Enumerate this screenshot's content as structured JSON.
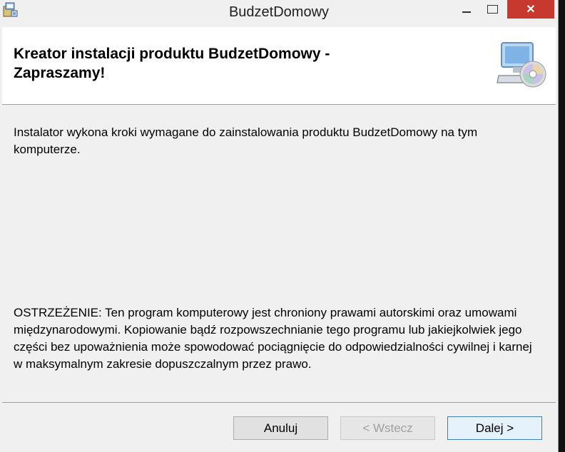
{
  "window": {
    "title": "BudzetDomowy",
    "icons": {
      "app": "installer-package-icon",
      "header": "computer-cd-icon"
    },
    "controls": {
      "minimize": "minimize-icon",
      "maximize": "maximize-icon",
      "close": "close-icon"
    },
    "close_color": "#c7392e"
  },
  "header": {
    "title_line1": "Kreator instalacji produktu BudzetDomowy -",
    "title_line2": "Zapraszamy!"
  },
  "body": {
    "intro_text": "Instalator wykona kroki wymagane do zainstalowania produktu BudzetDomowy na tym komputerze.",
    "warning_text": "OSTRZEŻENIE: Ten program komputerowy jest chroniony prawami autorskimi oraz umowami międzynarodowymi. Kopiowanie bądź rozpowszechnianie tego programu lub jakiejkolwiek jego części bez upoważnienia może spowodować pociągnięcie do odpowiedzialności cywilnej i karnej w maksymalnym zakresie dopuszczalnym przez prawo."
  },
  "buttons": {
    "cancel": "Anuluj",
    "back": "< Wstecz",
    "next": "Dalej >"
  }
}
